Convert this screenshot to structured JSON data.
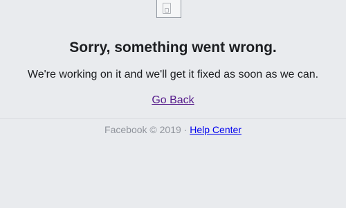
{
  "error": {
    "title": "Sorry, something went wrong.",
    "message": "We're working on it and we'll get it fixed as soon as we can.",
    "go_back_label": "Go Back"
  },
  "footer": {
    "copyright": "Facebook © 2019",
    "separator": "·",
    "help_center_label": "Help Center"
  },
  "colors": {
    "background": "#e9ebee",
    "text": "#1c1e21",
    "visited_link": "#551a8b",
    "link": "#0000ee",
    "muted": "#90949c"
  },
  "icons": {
    "top_image": "broken-image-icon"
  }
}
